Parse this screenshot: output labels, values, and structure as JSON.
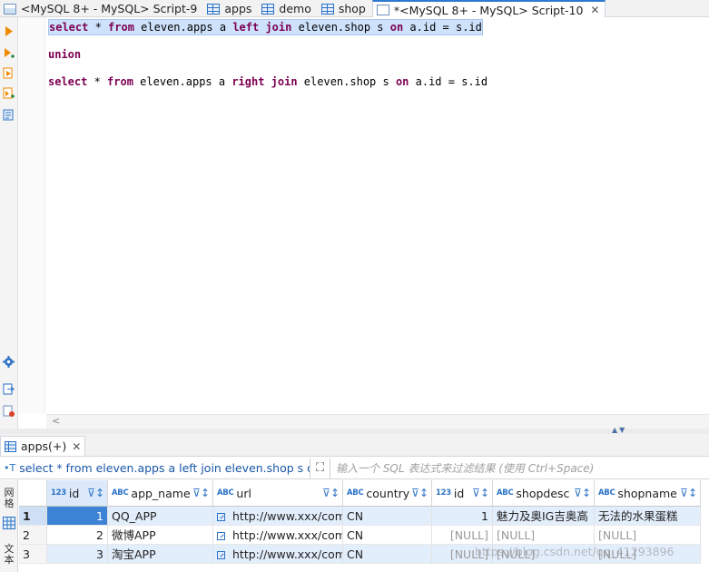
{
  "tabs": [
    {
      "label": "<MySQL 8+ - MySQL> Script-9",
      "icon": "sql-script-icon",
      "active": false
    },
    {
      "label": "apps",
      "icon": "table-icon",
      "active": false
    },
    {
      "label": "demo",
      "icon": "table-icon",
      "active": false
    },
    {
      "label": "shop",
      "icon": "table-icon",
      "active": false
    },
    {
      "label": "*<MySQL 8+ - MySQL> Script-10",
      "icon": "sql-file-icon",
      "active": true,
      "close": "✕"
    }
  ],
  "editor": {
    "line1": {
      "k1": "select",
      "t1": " * ",
      "k2": "from",
      "t2": " eleven.apps a ",
      "k3": "left join",
      "t3": " eleven.shop s ",
      "k4": "on",
      "t4": " a.id = s.id"
    },
    "line2": {
      "k1": "union"
    },
    "line3": {
      "k1": "select",
      "t1": " * ",
      "k2": "from",
      "t2": " eleven.apps a ",
      "k3": "right join",
      "t3": " eleven.shop s ",
      "k4": "on",
      "t4": " a.id = s.id"
    }
  },
  "results": {
    "tab_label": "apps(+)",
    "tab_close": "✕",
    "query_text": "select * from eleven.apps a left join eleven.shop s on a",
    "filter_placeholder": "输入一个 SQL 表达式来过滤结果 (使用 Ctrl+Space)",
    "side_tabs": {
      "grid": "网格",
      "text": "文本"
    },
    "columns": [
      {
        "name": "id",
        "type": "123"
      },
      {
        "name": "app_name",
        "type": "ABC"
      },
      {
        "name": "url",
        "type": "ABC"
      },
      {
        "name": "country",
        "type": "ABC"
      },
      {
        "name": "id",
        "type": "123"
      },
      {
        "name": "shopdesc",
        "type": "ABC"
      },
      {
        "name": "shopname",
        "type": "ABC"
      }
    ],
    "rows": [
      {
        "n": "1",
        "id": "1",
        "app_name": "QQ_APP",
        "url": "http://www.xxx/com",
        "country": "CN",
        "id2": "1",
        "shopdesc": "魅力及奥IG吉奥高",
        "shopname": "无法的水果蛋糕"
      },
      {
        "n": "2",
        "id": "2",
        "app_name": "微博APP",
        "url": "http://www.xxx/com",
        "country": "CN",
        "id2": "[NULL]",
        "shopdesc": "[NULL]",
        "shopname": "[NULL]"
      },
      {
        "n": "3",
        "id": "3",
        "app_name": "淘宝APP",
        "url": "http://www.xxx/com",
        "country": "CN",
        "id2": "[NULL]",
        "shopdesc": "[NULL]",
        "shopname": "[NULL]"
      }
    ]
  },
  "watermark": "https://blog.csdn.net/qq_41293896"
}
